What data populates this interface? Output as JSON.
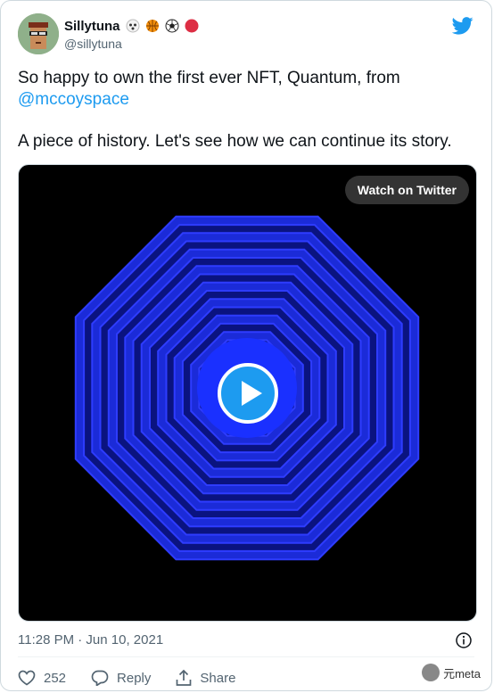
{
  "user": {
    "display_name": "Sillytuna",
    "handle": "@sillytuna",
    "badges": [
      "face-emoji",
      "basketball-emoji",
      "soccer-ball-emoji",
      "red-circle-emoji"
    ]
  },
  "tweet": {
    "text_line_1": "So happy to own the first ever NFT, Quantum, from",
    "mention": "@mccoyspace",
    "text_line_2": "A piece of history. Let's see how we can continue its story."
  },
  "media": {
    "watch_label": "Watch on Twitter",
    "play_icon": "play-icon"
  },
  "meta": {
    "timestamp": "11:28 PM · Jun 10, 2021"
  },
  "actions": {
    "like_count": "252",
    "reply_label": "Reply",
    "share_label": "Share"
  },
  "watermark": {
    "text": "元meta"
  },
  "colors": {
    "accent": "#1d9bf0",
    "text": "#0f1419",
    "muted": "#536471",
    "art_blue": "#1b2bd8"
  }
}
